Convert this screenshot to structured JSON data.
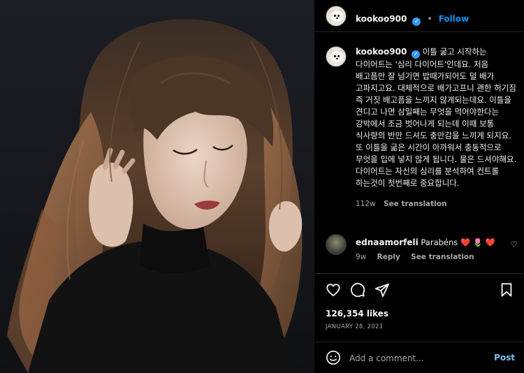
{
  "header": {
    "username": "kookoo900",
    "separator": "•",
    "follow_label": "Follow"
  },
  "caption": {
    "username": "kookoo900",
    "text": "이틀 굶고 시작하는 다이어트는 '심리 다이어트'인데요. 처음 배고픔만 잘 넘기면 밥때가되어도 덜 배가 고파지고요. 대체적으로 배가고프니 괜한 허기짐 즉 거짓 배고픔을 느끼지 않게되는데요. 이틀을 견디고 나면 삼일째는 무엇을 먹어야한다는 강박에서 조금 벗어나게 되는데 이때 보통 식사량의 반만 드셔도 충만감을 느끼게 되지요. 또 이틀을 굶은 시간이 아까워서 충동적으로 무엇을 입에 넣지 않게 됩니다. 물은 드셔야해요. 다이어트는 자신의 심리를 분석하여 컨트롤 하는것이 첫번째로 중요합니다.",
    "age": "112w",
    "see_translation": "See translation"
  },
  "comment": {
    "username": "ednaamorfeli",
    "text": "Parabéns",
    "emojis": "❤️ 🌷 ❤️",
    "age": "9w",
    "reply_label": "Reply",
    "see_translation": "See translation"
  },
  "actions": {
    "likes": "126,354 likes",
    "date": "JANUARY 28, 2021"
  },
  "add_comment": {
    "placeholder": "Add a comment...",
    "post_label": "Post"
  },
  "colors": {
    "background": "#000000",
    "accent": "#0095f6",
    "post_button": "#7ac2f5",
    "verified": "#3897f0",
    "muted_text": "#a8a8a8",
    "divider": "#262626",
    "heart_red": "#ed4956"
  },
  "icons": {
    "verified": "verified-badge-icon",
    "like": "heart-icon",
    "comment": "comment-bubble-icon",
    "share": "paper-plane-icon",
    "save": "bookmark-icon",
    "emoji": "smiley-icon",
    "comment_like": "heart-small-icon"
  }
}
